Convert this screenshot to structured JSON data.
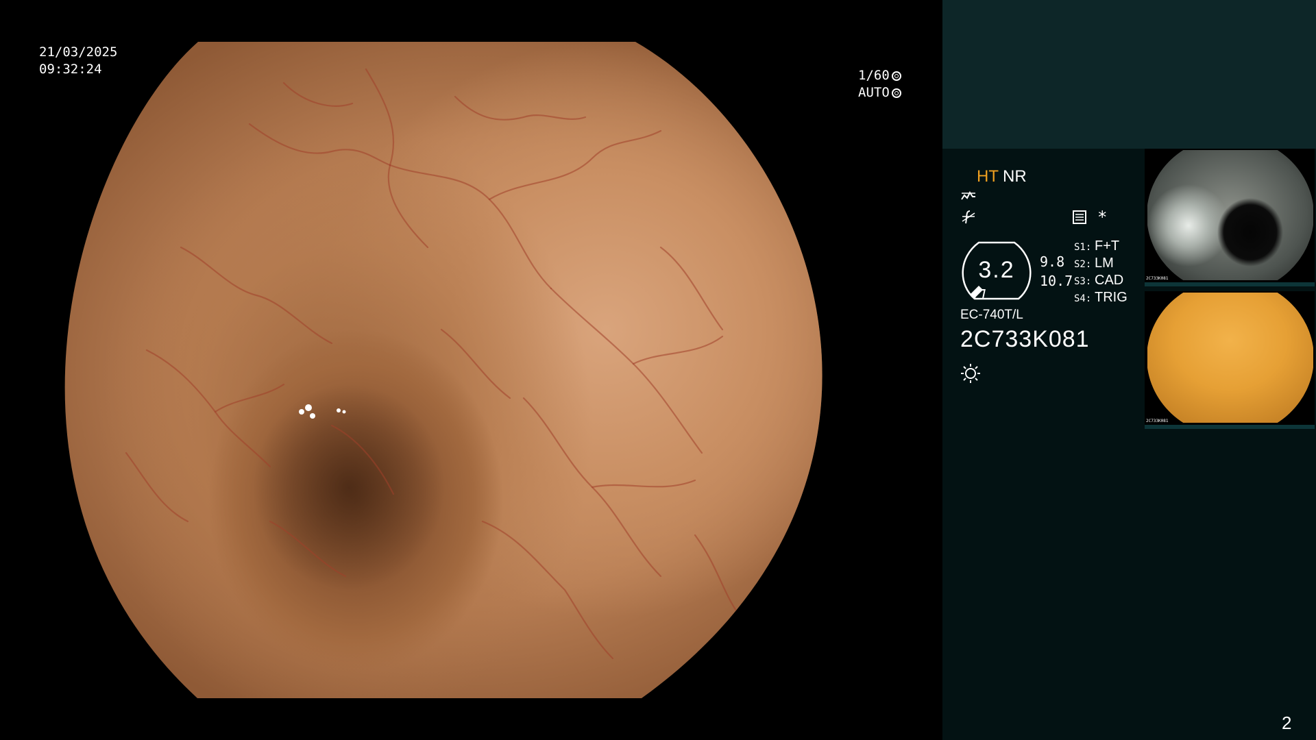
{
  "overlay": {
    "date": "21/03/2025",
    "time": "09:32:24",
    "shutter": "1/60",
    "exposure_mode": "AUTO"
  },
  "processor": {
    "mode_ht": "HT",
    "mode_nr": "NR",
    "star": "*",
    "zoom_value": "3.2",
    "zoom_min": "9.8",
    "zoom_max": "10.7",
    "switches": [
      {
        "key": "S1:",
        "value": "F+T"
      },
      {
        "key": "S2:",
        "value": "LM"
      },
      {
        "key": "S3:",
        "value": "CAD"
      },
      {
        "key": "S4:",
        "value": "TRIG"
      }
    ],
    "scope_model": "EC-740T/L",
    "scope_serial": "2C733K081"
  },
  "thumbnails": [
    {
      "name": "thumbnail-1",
      "label": "2C733K081"
    },
    {
      "name": "thumbnail-2",
      "label": "2C733K081"
    }
  ],
  "page_number": "2",
  "colors": {
    "panel_bg": "#031213",
    "panel_top": "#0d2628",
    "ht_accent": "#f0a020"
  }
}
